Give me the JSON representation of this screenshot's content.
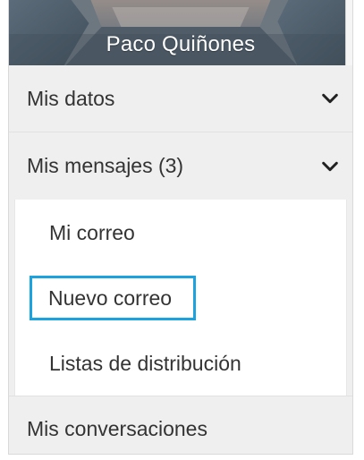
{
  "profile": {
    "name": "Paco Quiñones"
  },
  "menu": {
    "items": [
      {
        "label": "Mis datos",
        "icon": "chevron-down-icon"
      },
      {
        "label": "Mis mensajes (3)",
        "icon": "chevron-down-icon"
      }
    ],
    "submenu": [
      {
        "label": "Mi correo"
      },
      {
        "label": "Nuevo correo",
        "active": true
      },
      {
        "label": "Listas de distribución"
      }
    ],
    "last_item": {
      "label": "Mis conversaciones"
    }
  },
  "colors": {
    "highlight": "#1aa3de",
    "menu_bg": "#efefef",
    "submenu_bg": "#ffffff",
    "text": "#333333"
  }
}
